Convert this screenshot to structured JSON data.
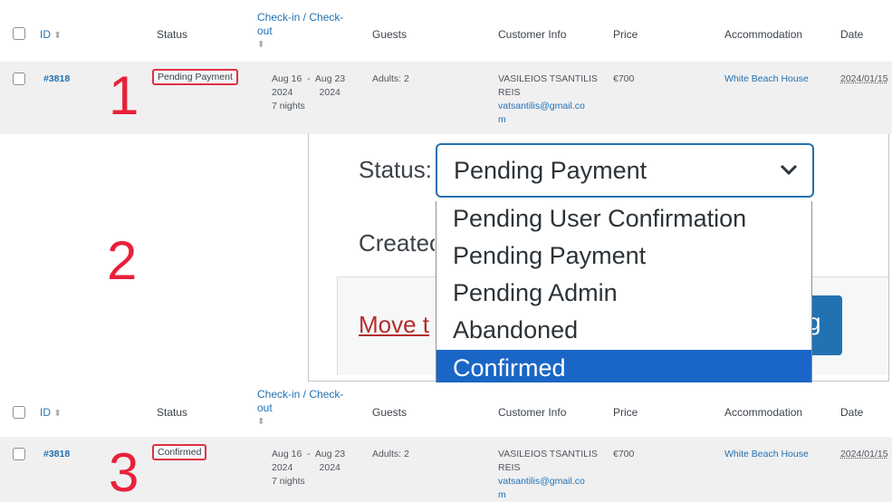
{
  "table_header": {
    "id": "ID",
    "status": "Status",
    "checkin_line1": "Check-in / Check-",
    "checkin_line2": "out",
    "guests": "Guests",
    "customer_info": "Customer Info",
    "price": "Price",
    "accommodation": "Accommodation",
    "date": "Date"
  },
  "row_top": {
    "id": "#3818",
    "status": "Pending Payment",
    "checkin_l1": "Aug 16  -  Aug 23",
    "checkin_l2": "2024          2024",
    "checkin_l3": "7 nights",
    "guests": "Adults: 2",
    "customer_name_l1": "VASILEIOS TSANTILIS",
    "customer_name_l2": "REIS",
    "customer_email_l1": "vatsantilis@gmail.co",
    "customer_email_l2": "m",
    "price": "€700",
    "accommodation": "White Beach House",
    "date": "2024/01/15"
  },
  "row_bottom": {
    "id": "#3818",
    "status": "Confirmed",
    "checkin_l1": "Aug 16  -  Aug 23",
    "checkin_l2": "2024          2024",
    "checkin_l3": "7 nights",
    "guests": "Adults: 2",
    "customer_name_l1": "VASILEIOS TSANTILIS",
    "customer_name_l2": "REIS",
    "customer_email_l1": "vatsantilis@gmail.co",
    "customer_email_l2": "m",
    "price": "€700",
    "accommodation": "White Beach House",
    "date": "2024/01/15"
  },
  "step_labels": [
    "1",
    "2",
    "3"
  ],
  "zoom": {
    "status_label": "Status:",
    "created_label": "Createc",
    "move_link": "Move t",
    "selected_value": "Pending Payment",
    "options": [
      "Pending User Confirmation",
      "Pending Payment",
      "Pending Admin",
      "Abandoned",
      "Confirmed"
    ],
    "highlighted_option": "Confirmed",
    "button_fragment": "g"
  },
  "colors": {
    "accent": "#2271b1",
    "highlight_red": "#e8213a",
    "selected_option_bg": "#1a66c7",
    "row_bg": "#f0f0f1"
  },
  "icons": [
    "sort-arrows-icon",
    "chevron-down-icon",
    "checkbox"
  ]
}
